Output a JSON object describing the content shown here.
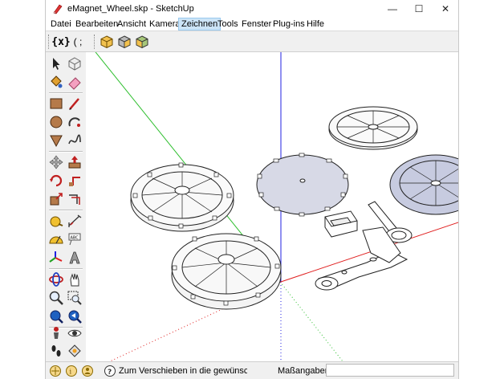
{
  "window": {
    "title": "eMagnet_Wheel.skp - SketchUp",
    "controls": {
      "minimize": "—",
      "maximize": "☐",
      "close": "✕"
    }
  },
  "menubar": {
    "items": [
      "Datei",
      "Bearbeiten",
      "Ansicht",
      "Kamera",
      "Zeichnen",
      "Tools",
      "Fenster",
      "Plug-ins",
      "Hilfe"
    ],
    "active": "Zeichnen"
  },
  "toolbar": {
    "ruby_console_label": "{x}",
    "ruby_console_suffix": "( ;",
    "icons": [
      "ruby-console-icon",
      "component-box-icon",
      "component-options-icon",
      "component-attributes-icon"
    ]
  },
  "left_toolbar": {
    "icons": [
      "select-icon",
      "make-component-icon",
      "paint-bucket-icon",
      "eraser-icon",
      "rectangle-icon",
      "line-icon",
      "circle-icon",
      "arc-icon",
      "polygon-icon",
      "freehand-icon",
      "move-icon",
      "push-pull-icon",
      "rotate-icon",
      "follow-me-icon",
      "scale-icon",
      "offset-icon",
      "tape-measure-icon",
      "dimension-icon",
      "protractor-icon",
      "text-icon",
      "axes-icon",
      "3d-text-icon",
      "orbit-icon",
      "pan-icon",
      "zoom-icon",
      "zoom-window-icon",
      "zoom-extents-icon",
      "previous-view-icon",
      "position-camera-icon",
      "look-around-icon",
      "walk-icon",
      "section-plane-icon"
    ]
  },
  "statusbar": {
    "hint": "Zum Verschieben in die gewünschte",
    "measurements_label": "Maßangaben",
    "measurements_value": ""
  },
  "colors": {
    "axis_green": "#2fbf2f",
    "axis_blue": "#2020e0",
    "axis_red": "#e02020",
    "selection_face": "#c7cbe0",
    "menu_highlight": "#cce4f7"
  }
}
